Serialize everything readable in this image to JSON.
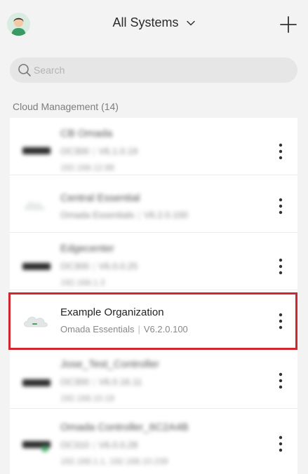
{
  "header": {
    "title": "All Systems",
    "avatar_icon": "user-avatar",
    "dropdown_icon": "chevron-down-icon",
    "add_icon": "plus-icon"
  },
  "search": {
    "placeholder": "Search",
    "value": ""
  },
  "section": {
    "label": "Cloud Management (14)"
  },
  "systems": [
    {
      "name": "CB Omada",
      "model": "OC300",
      "version": "V6.1.0.19",
      "ip": "192.168.12.88",
      "blurred": true
    },
    {
      "name": "Central Essential",
      "model": "Omada Essentials",
      "version": "V6.2.0.100",
      "ip": "",
      "blurred": true
    },
    {
      "name": "Edgecenter",
      "model": "OC300",
      "version": "V6.0.0.25",
      "ip": "192.168.1.3",
      "blurred": true
    },
    {
      "name": "Example Organization",
      "model": "Omada Essentials",
      "version": "V6.2.0.100",
      "ip": "",
      "blurred": false
    },
    {
      "name": "Jose_Test_Controller",
      "model": "OC300",
      "version": "V6.0.16.11",
      "ip": "192.168.10.19",
      "blurred": true
    },
    {
      "name": "Omada Controller_6C2A4B",
      "model": "OC310",
      "version": "V6.0.0.28",
      "ip": "192.168.1.1, 192.168.10.239",
      "blurred": true
    }
  ],
  "colors": {
    "highlight": "#d0262d",
    "background": "#f3f3f3"
  }
}
